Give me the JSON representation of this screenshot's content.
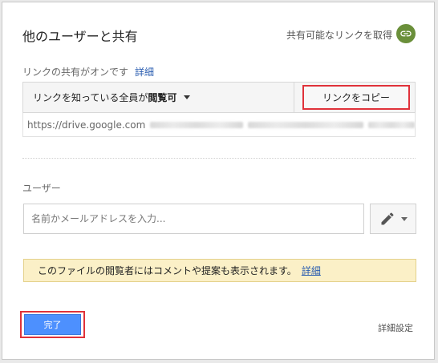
{
  "dialog": {
    "title": "他のユーザーと共有",
    "get_link_label": "共有可能なリンクを取得",
    "get_link_icon": "link-icon",
    "icon_color": "#6a8f3a"
  },
  "link_sharing": {
    "status_text": "リンクの共有がオンです",
    "detail_label": "詳細",
    "access_prefix": "リンクを知っている全員が",
    "access_level": "閲覧可",
    "copy_label": "リンクをコピー",
    "url_visible": "https://drive.google.com"
  },
  "users": {
    "label": "ユーザー",
    "input_placeholder": "名前かメールアドレスを入力...",
    "edit_icon": "pencil-icon"
  },
  "notice": {
    "text": "このファイルの閲覧者にはコメントや提案も表示されます。",
    "link_label": "詳細",
    "background": "#fbf0c7"
  },
  "footer": {
    "done_label": "完了",
    "advanced_label": "詳細設定",
    "done_color": "#4d90fe",
    "highlight_color": "#e0323a"
  }
}
